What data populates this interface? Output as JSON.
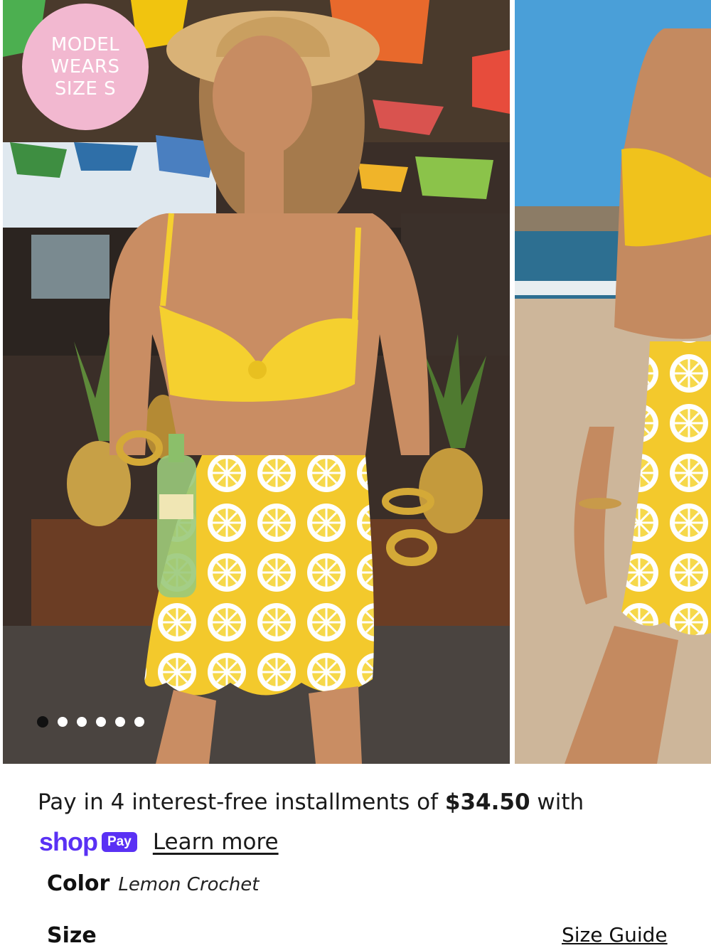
{
  "gallery": {
    "badge_lines": [
      "MODEL",
      "WEARS",
      "SIZE S"
    ],
    "dot_count": 6,
    "active_dot": 0,
    "images": [
      {
        "name": "model-market-photo"
      },
      {
        "name": "model-beach-photo"
      }
    ]
  },
  "payment": {
    "prefix": "Pay in 4 interest-free installments of ",
    "amount": "$34.50",
    "suffix": " with",
    "shop_logo": "shop",
    "pay_pill": "Pay",
    "learn_more": "Learn more"
  },
  "color": {
    "label": "Color",
    "value": "Lemon Crochet"
  },
  "size": {
    "label": "Size",
    "guide": "Size Guide"
  },
  "colors": {
    "brand_purple": "#5a31f4",
    "badge_pink": "#f2b8d0",
    "garment_yellow": "#f5cf2e"
  }
}
